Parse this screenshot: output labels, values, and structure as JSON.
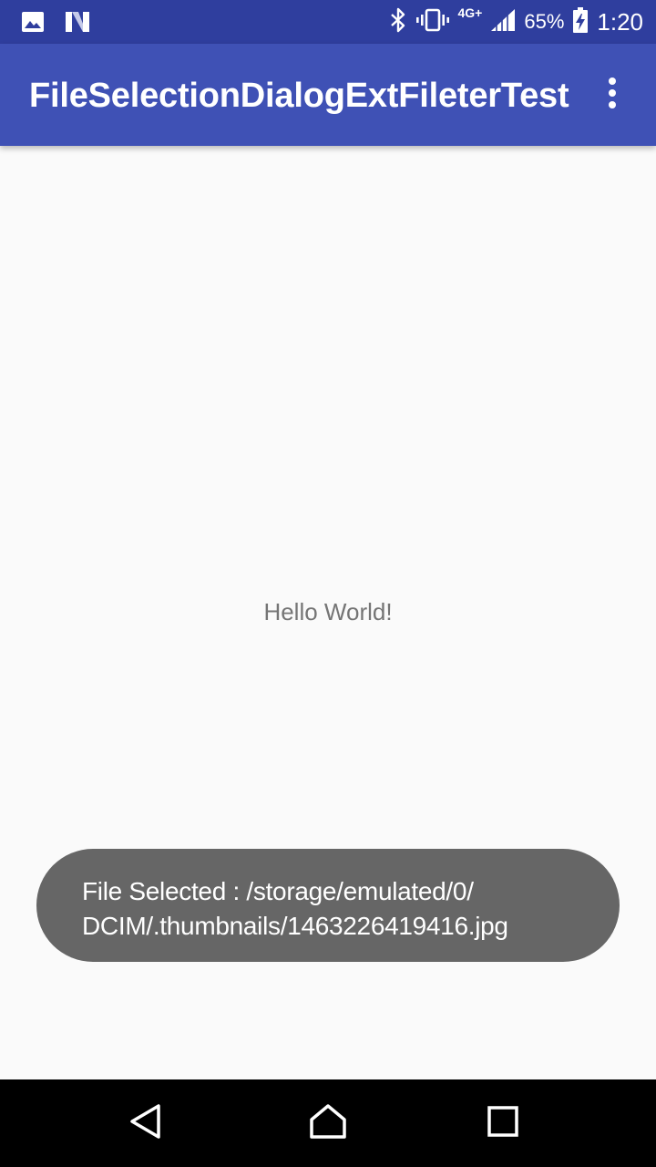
{
  "status_bar": {
    "left_icons": [
      "image-icon",
      "n-icon"
    ],
    "right_icons": [
      "bluetooth-icon",
      "vibrate-icon",
      "signal-icon",
      "battery-charging-icon"
    ],
    "network_type": "4G+",
    "battery_percent": "65%",
    "time": "1:20",
    "background_color": "#2f3e9e"
  },
  "app_bar": {
    "title": "FileSelectionDialogExtFileterTest",
    "overflow_icon": "more-vert-icon",
    "background_color": "#3f51b5"
  },
  "main": {
    "hello_text": "Hello World!"
  },
  "toast": {
    "line1": "File Selected : /storage/emulated/0/",
    "line2": "DCIM/.thumbnails/1463226419416.jpg",
    "background_color": "#666666"
  },
  "nav_bar": {
    "buttons": [
      "back-icon",
      "home-icon",
      "recents-icon"
    ]
  }
}
